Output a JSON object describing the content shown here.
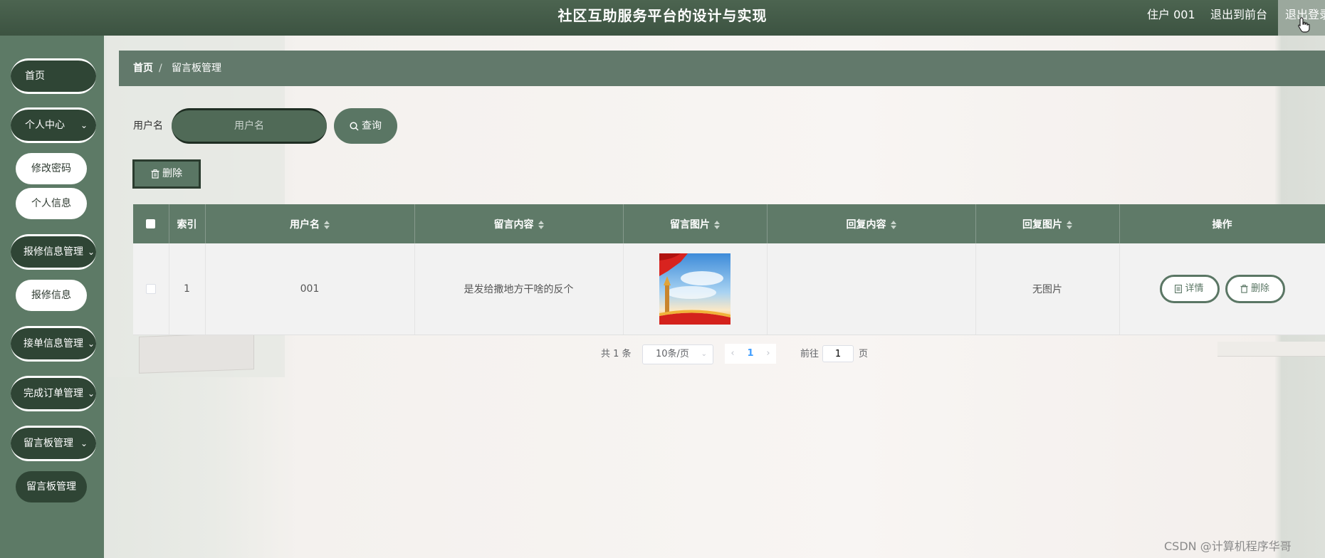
{
  "header": {
    "title": "社区互助服务平台的设计与实现",
    "user": "住户 001",
    "front_link": "退出到前台",
    "logout": "退出登录"
  },
  "sidebar": {
    "items": [
      {
        "label": "首页"
      },
      {
        "label": "个人中心",
        "children": [
          "修改密码",
          "个人信息"
        ]
      },
      {
        "label": "报修信息管理",
        "children": [
          "报修信息"
        ]
      },
      {
        "label": "接单信息管理"
      },
      {
        "label": "完成订单管理"
      },
      {
        "label": "留言板管理",
        "children": [
          "留言板管理"
        ]
      }
    ]
  },
  "breadcrumb": {
    "home": "首页",
    "separator": "/",
    "current": "留言板管理"
  },
  "search": {
    "label": "用户名",
    "placeholder": "用户名",
    "button": "查询"
  },
  "toolbar": {
    "delete": "删除"
  },
  "table": {
    "columns": [
      "索引",
      "用户名",
      "留言内容",
      "留言图片",
      "回复内容",
      "回复图片",
      "操作"
    ],
    "rows": [
      {
        "index": "1",
        "username": "001",
        "content": "是发给撒地方干啥的反个",
        "reply": "",
        "reply_image": "无图片",
        "detail": "详情",
        "delete": "删除"
      }
    ]
  },
  "pagination": {
    "total": "共 1 条",
    "page_size": "10条/页",
    "current_page": "1",
    "goto": "前往",
    "goto_value": "1",
    "page_unit": "页"
  },
  "watermark": "CSDN @计算机程序华哥",
  "colors": {
    "primary": "#5f7a68",
    "dark": "#2f4535",
    "topbar": "#44594a"
  }
}
